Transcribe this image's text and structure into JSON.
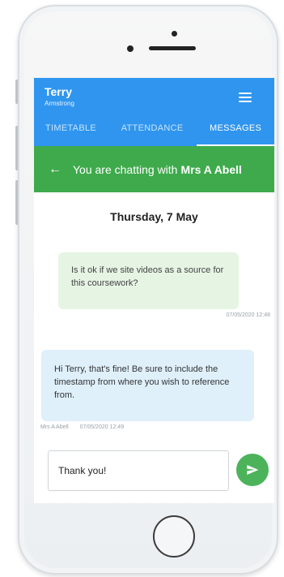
{
  "header": {
    "user_name": "Terry",
    "user_subtitle": "Armstrong"
  },
  "tabs": [
    {
      "label": "TIMETABLE",
      "active": false
    },
    {
      "label": "ATTENDANCE",
      "active": false
    },
    {
      "label": "MESSAGES",
      "active": true
    }
  ],
  "chat": {
    "prefix": "You are chatting with",
    "contact": "Mrs A Abell",
    "date": "Thursday, 7 May",
    "messages": [
      {
        "direction": "sent",
        "text": "Is it ok if we site videos as a source for this coursework?",
        "timestamp": "07/05/2020 12:48"
      },
      {
        "direction": "received",
        "text": "Hi Terry, that's fine! Be sure to include the timestamp from where you wish to reference from.",
        "sender": "Mrs A Abell",
        "timestamp": "07/05/2020 12:49"
      }
    ]
  },
  "composer": {
    "value": "Thank you!"
  },
  "colors": {
    "appbar": "#2f95ef",
    "chatbar": "#3eaa4c",
    "sent_bubble": "#e6f4e4",
    "received_bubble": "#dff0fb",
    "send_button": "#4cb35a"
  },
  "icons": {
    "menu": "hamburger-menu-icon",
    "back": "arrow-left-icon",
    "send": "send-icon"
  }
}
